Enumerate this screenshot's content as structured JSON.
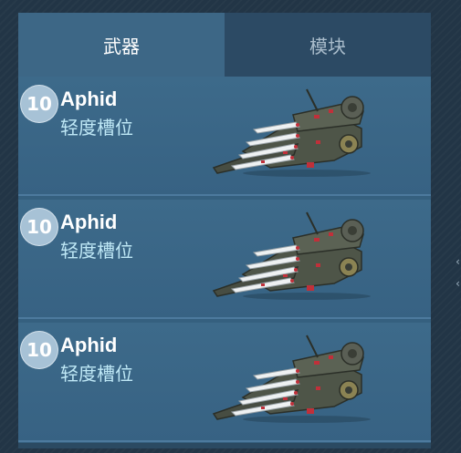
{
  "tabs": [
    {
      "label": "武器",
      "active": true
    },
    {
      "label": "模块",
      "active": false
    }
  ],
  "items": [
    {
      "level": "10",
      "name": "Aphid",
      "slot": "轻度槽位",
      "icon": "missile-launcher-icon"
    },
    {
      "level": "10",
      "name": "Aphid",
      "slot": "轻度槽位",
      "icon": "missile-launcher-icon"
    },
    {
      "level": "10",
      "name": "Aphid",
      "slot": "轻度槽位",
      "icon": "missile-launcher-icon"
    }
  ],
  "colors": {
    "panel": "#35607f",
    "tab_active": "#3d6786",
    "tab_inactive": "#2c4a64",
    "slot_text": "#bfe8f6",
    "level_badge": "#a7c2d6"
  }
}
